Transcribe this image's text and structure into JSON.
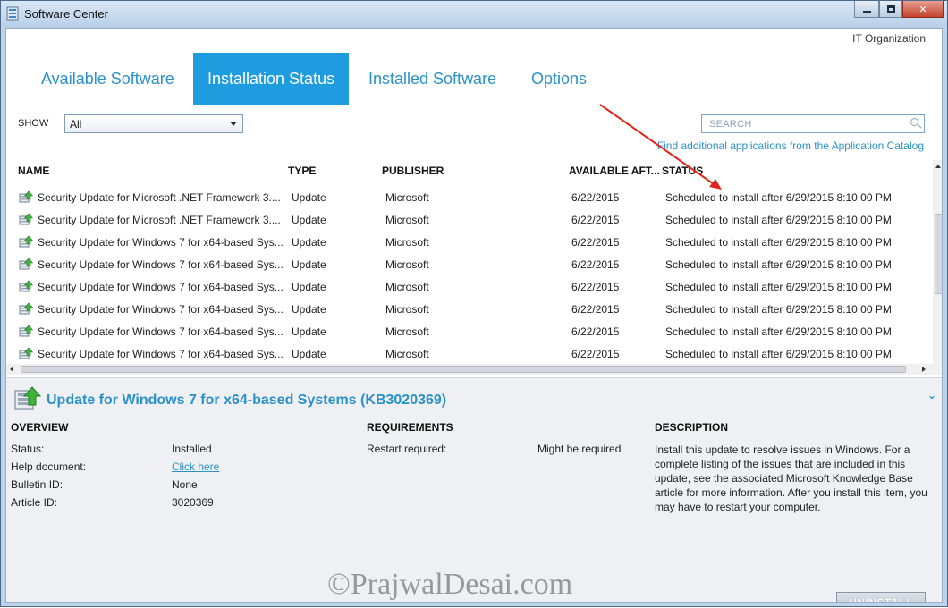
{
  "window": {
    "title": "Software Center"
  },
  "header": {
    "org": "IT Organization"
  },
  "tabs": [
    {
      "label": "Available Software",
      "active": false
    },
    {
      "label": "Installation Status",
      "active": true
    },
    {
      "label": "Installed Software",
      "active": false
    },
    {
      "label": "Options",
      "active": false
    }
  ],
  "filter": {
    "label": "SHOW",
    "value": "All"
  },
  "search": {
    "placeholder": "SEARCH"
  },
  "catalog_link": "Find additional applications from the Application Catalog",
  "table": {
    "columns": [
      "NAME",
      "TYPE",
      "PUBLISHER",
      "AVAILABLE AFT...",
      "STATUS"
    ],
    "rows": [
      {
        "name": "Security Update for Microsoft .NET Framework 3....",
        "type": "Update",
        "publisher": "Microsoft",
        "available": "6/22/2015",
        "status": "Scheduled to install after 6/29/2015 8:10:00 PM"
      },
      {
        "name": "Security Update for Microsoft .NET Framework 3....",
        "type": "Update",
        "publisher": "Microsoft",
        "available": "6/22/2015",
        "status": "Scheduled to install after 6/29/2015 8:10:00 PM"
      },
      {
        "name": "Security Update for Windows 7 for x64-based Sys...",
        "type": "Update",
        "publisher": "Microsoft",
        "available": "6/22/2015",
        "status": "Scheduled to install after 6/29/2015 8:10:00 PM"
      },
      {
        "name": "Security Update for Windows 7 for x64-based Sys...",
        "type": "Update",
        "publisher": "Microsoft",
        "available": "6/22/2015",
        "status": "Scheduled to install after 6/29/2015 8:10:00 PM"
      },
      {
        "name": "Security Update for Windows 7 for x64-based Sys...",
        "type": "Update",
        "publisher": "Microsoft",
        "available": "6/22/2015",
        "status": "Scheduled to install after 6/29/2015 8:10:00 PM"
      },
      {
        "name": "Security Update for Windows 7 for x64-based Sys...",
        "type": "Update",
        "publisher": "Microsoft",
        "available": "6/22/2015",
        "status": "Scheduled to install after 6/29/2015 8:10:00 PM"
      },
      {
        "name": "Security Update for Windows 7 for x64-based Sys...",
        "type": "Update",
        "publisher": "Microsoft",
        "available": "6/22/2015",
        "status": "Scheduled to install after 6/29/2015 8:10:00 PM"
      },
      {
        "name": "Security Update for Windows 7 for x64-based Sys...",
        "type": "Update",
        "publisher": "Microsoft",
        "available": "6/22/2015",
        "status": "Scheduled to install after 6/29/2015 8:10:00 PM"
      }
    ]
  },
  "details": {
    "title": "Update for Windows 7 for x64-based Systems (KB3020369)",
    "overview": {
      "heading": "OVERVIEW",
      "status_label": "Status:",
      "status_value": "Installed",
      "help_label": "Help document:",
      "help_value": "Click here",
      "bulletin_label": "Bulletin ID:",
      "bulletin_value": "None",
      "article_label": "Article ID:",
      "article_value": "3020369"
    },
    "requirements": {
      "heading": "REQUIREMENTS",
      "restart_label": "Restart required:",
      "restart_value": "Might be required"
    },
    "description": {
      "heading": "DESCRIPTION",
      "text": "Install this update to resolve issues in Windows. For a complete listing of the issues that are included in this update, see the associated Microsoft Knowledge Base article for more information. After you install this item, you may have to restart your computer."
    },
    "uninstall_label": "UNINSTALL"
  },
  "watermark": "©PrajwalDesai.com",
  "colors": {
    "accent": "#1f9be0",
    "link": "#2a92c8",
    "annotation_arrow": "#e0251b"
  },
  "icons": {
    "row_icon": "update-package-icon",
    "detail_icon": "update-package-icon",
    "collapse": "chevron-down-icon"
  }
}
